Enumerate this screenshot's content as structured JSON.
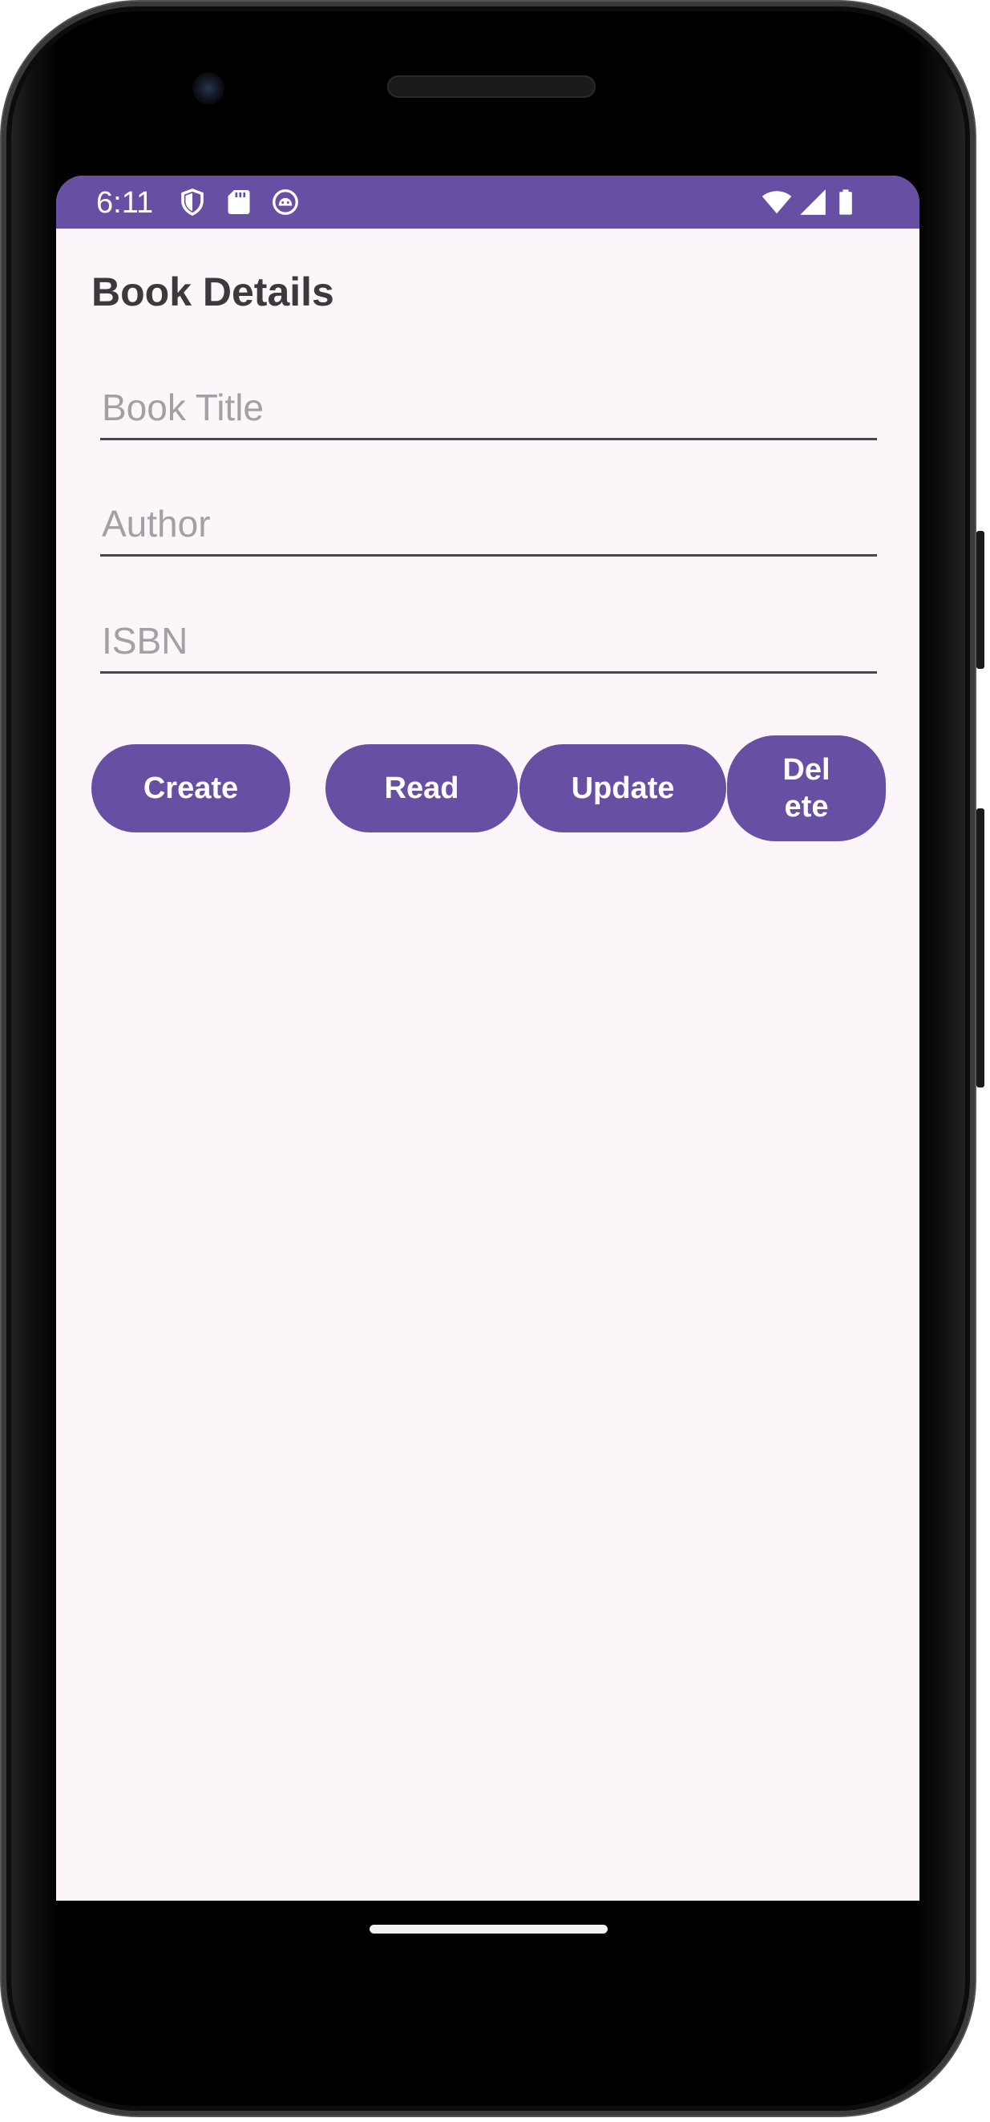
{
  "status_bar": {
    "time": "6:11",
    "left_icons": [
      "shield-icon",
      "sd-card-icon",
      "android-debug-icon"
    ],
    "right_icons": [
      "wifi-icon",
      "signal-icon",
      "battery-icon"
    ],
    "color": "#6750a4"
  },
  "screen": {
    "title": "Book Details"
  },
  "form": {
    "book_title": {
      "placeholder": "Book Title",
      "value": ""
    },
    "author": {
      "placeholder": "Author",
      "value": ""
    },
    "isbn": {
      "placeholder": "ISBN",
      "value": ""
    }
  },
  "actions": {
    "create_label": "Create",
    "read_label": "Read",
    "update_label": "Update",
    "delete_label": "Delete"
  },
  "colors": {
    "accent": "#6750a4",
    "background": "#fcf6fb",
    "title_text": "#3b383e",
    "placeholder_text": "#a29fa5"
  }
}
